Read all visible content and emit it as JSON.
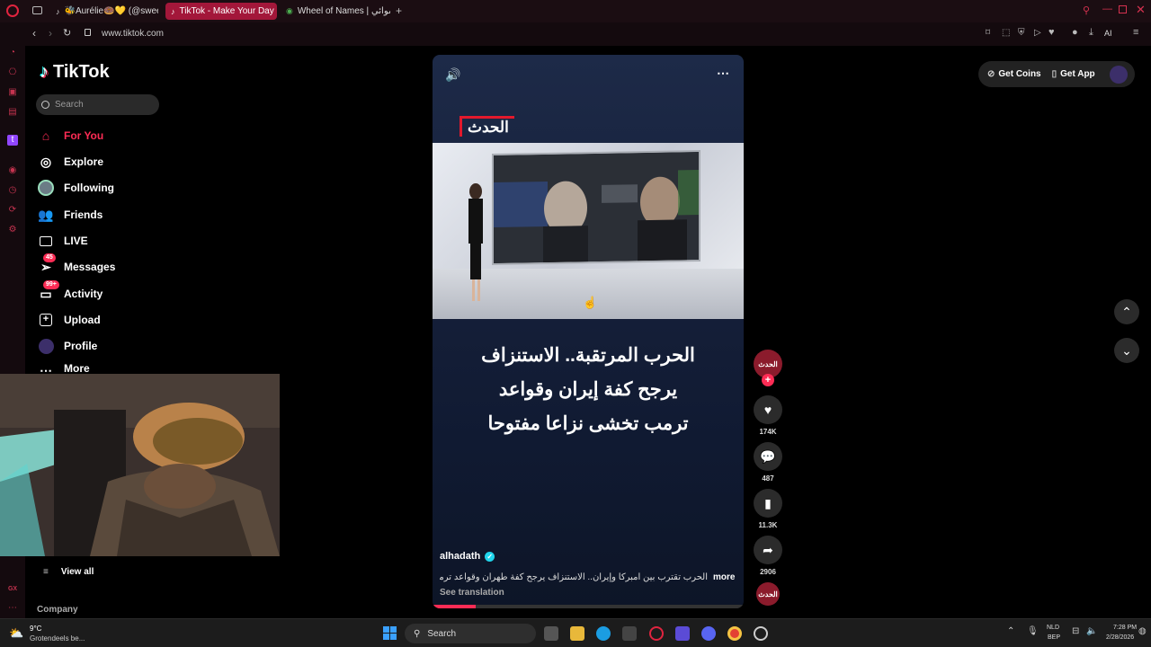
{
  "browser": {
    "tabs": [
      {
        "label": "🐝Aurélie🍩💛 (@sweety",
        "icon": "tiktok-icon"
      },
      {
        "label": "TikTok - Make Your Day",
        "icon": "tiktok-icon",
        "active": true
      },
      {
        "label": "Wheel of Names | العشوائي",
        "icon": "wheel-icon"
      }
    ],
    "url": "www.tiktok.com",
    "ai_label": "AI"
  },
  "tiktok": {
    "logo": "TikTok",
    "search_placeholder": "Search",
    "nav": [
      {
        "label": "For You",
        "icon": "home-icon",
        "active": true
      },
      {
        "label": "Explore",
        "icon": "compass-icon"
      },
      {
        "label": "Following",
        "icon": "following-avatar-icon"
      },
      {
        "label": "Friends",
        "icon": "friends-icon"
      },
      {
        "label": "LIVE",
        "icon": "live-icon"
      },
      {
        "label": "Messages",
        "icon": "messages-icon",
        "badge": "45"
      },
      {
        "label": "Activity",
        "icon": "activity-icon",
        "badge": "99+"
      },
      {
        "label": "Upload",
        "icon": "upload-icon"
      },
      {
        "label": "Profile",
        "icon": "profile-icon"
      },
      {
        "label": "More",
        "icon": "more-icon"
      }
    ],
    "view_all": "View all",
    "company": "Company",
    "get_coins": "Get Coins",
    "get_app": "Get App"
  },
  "video": {
    "channel_brand": "الحدث",
    "headline_lines": [
      "الحرب المرتقبة.. الاستنزاف",
      "يرجح كفة إيران وقواعد",
      "ترمب تخشى نزاعا مفتوحا"
    ],
    "author": "alhadath",
    "caption": "الحرب تقترب بين أمبركا وإيران.. الاستنزاف يرجح كفة طهران وقواعد ترمب تخشى",
    "more": "more",
    "see_translation": "See translation",
    "progress_fraction": 0.14
  },
  "actions": {
    "likes": "174K",
    "comments": "487",
    "saves": "11.3K",
    "shares": "2906",
    "creator_avatar_text": "الحدث"
  },
  "taskbar": {
    "weather_temp": "9°C",
    "weather_desc": "Grotendeels be...",
    "search_label": "Search",
    "lang_line1": "NLD",
    "lang_line2": "BEP",
    "time": "7:28 PM",
    "date": "2/28/2026"
  },
  "colors": {
    "accent": "#fe2c55",
    "opera_red": "#a3173a",
    "taskbar": "#1c1c1c"
  }
}
